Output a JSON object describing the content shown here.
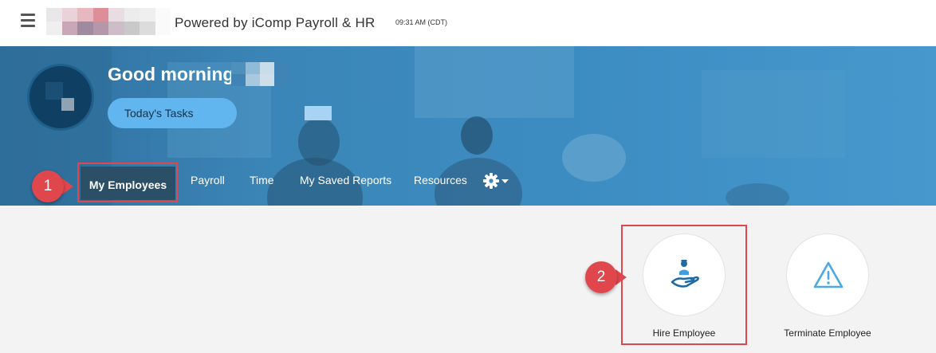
{
  "topbar": {
    "menu_icon": "hamburger-icon",
    "powered_by": "Powered by iComp Payroll & HR",
    "time": "09:31 AM (CDT)"
  },
  "hero": {
    "greeting": "Good morning,",
    "tasks_button": "Today's Tasks"
  },
  "nav": {
    "items": [
      {
        "label": "My Employees",
        "active": true
      },
      {
        "label": "Payroll"
      },
      {
        "label": "Time"
      },
      {
        "label": "My Saved Reports"
      },
      {
        "label": "Resources"
      }
    ],
    "settings_icon": "gear-icon"
  },
  "callouts": {
    "step1": "1",
    "step2": "2"
  },
  "actions": {
    "hire": {
      "label": "Hire Employee",
      "icon": "hire-hand-icon"
    },
    "terminate": {
      "label": "Terminate Employee",
      "icon": "warning-triangle-icon"
    }
  },
  "colors": {
    "accent": "#3c8cc2",
    "active_tab": "#2a4f66",
    "tasks_button": "#62b6f0",
    "callout": "#e0474c"
  }
}
